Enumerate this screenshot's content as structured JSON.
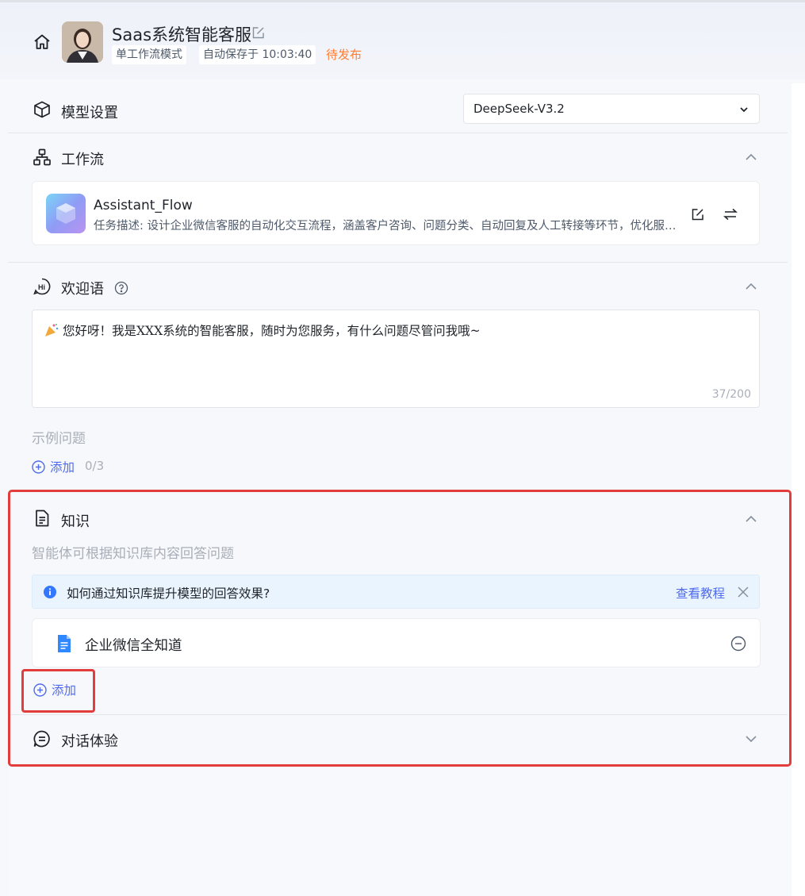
{
  "header": {
    "title": "Saas系统智能客服",
    "mode_tag": "单工作流模式",
    "autosave_tag": "自动保存于 10:03:40",
    "status": "待发布",
    "status_color": "#ff7d32"
  },
  "model": {
    "section_title": "模型设置",
    "selected": "DeepSeek-V3.2"
  },
  "workflow": {
    "section_title": "工作流",
    "name": "Assistant_Flow",
    "description": "任务描述: 设计企业微信客服的自动化交互流程，涵盖客户咨询、问题分类、自动回复及人工转接等环节，优化服务效率与客户体验。"
  },
  "welcome": {
    "section_title": "欢迎语",
    "text": "您好呀！我是XXX系统的智能客服，随时为您服务，有什么问题尽管问我哦~",
    "counter": "37/200",
    "examples_label": "示例问题",
    "add_label": "添加",
    "add_count": "0/3"
  },
  "knowledge": {
    "section_title": "知识",
    "subtitle": "智能体可根据知识库内容回答问题",
    "tip_text": "如何通过知识库提升模型的回答效果?",
    "tip_link": "查看教程",
    "items": [
      {
        "name": "企业微信全知道"
      }
    ],
    "add_label": "添加"
  },
  "conversation": {
    "section_title": "对话体验"
  },
  "colors": {
    "accent": "#4f6bef",
    "highlight": "#e23d3d",
    "tip_bg": "#eaf4fe"
  }
}
